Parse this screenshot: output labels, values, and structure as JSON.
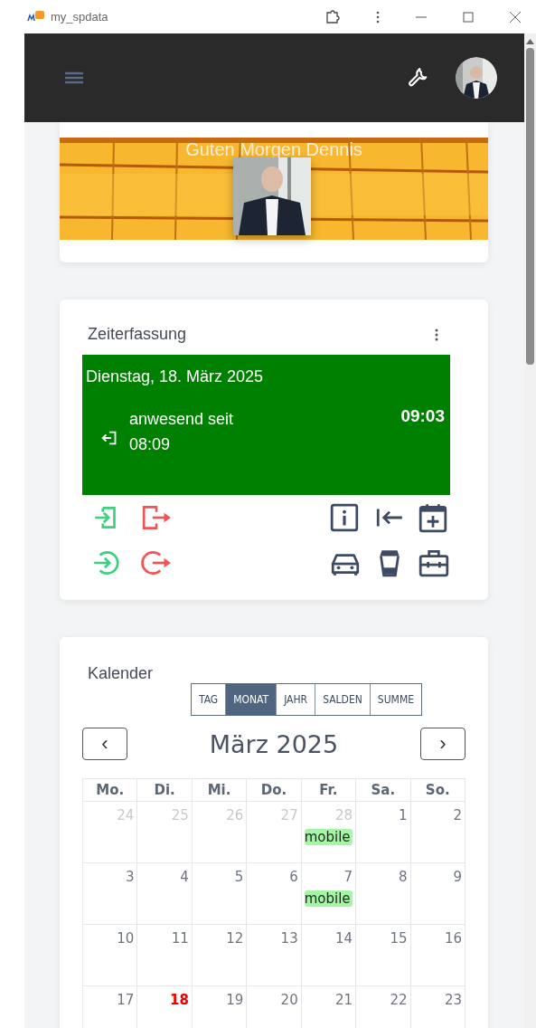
{
  "window": {
    "title": "my_spdata"
  },
  "greeting": {
    "text": "Guten Morgen Dennis"
  },
  "time_tracking": {
    "title": "Zeiterfassung",
    "date": "Dienstag, 18. März 2025",
    "status": "anwesend seit",
    "since": "08:09",
    "current_time": "09:03"
  },
  "calendar": {
    "title": "Kalender",
    "month": "März 2025",
    "prev": "‹",
    "next": "›",
    "views": [
      {
        "label": "TAG",
        "selected": false
      },
      {
        "label": "MONAT",
        "selected": true
      },
      {
        "label": "JAHR",
        "selected": false
      },
      {
        "label": "SALDEN",
        "selected": false
      },
      {
        "label": "SUMME",
        "selected": false
      }
    ],
    "weekdays": [
      "Mo.",
      "Di.",
      "Mi.",
      "Do.",
      "Fr.",
      "Sa.",
      "So."
    ],
    "weeks": [
      [
        {
          "day": "24",
          "outside": true,
          "today": false
        },
        {
          "day": "25",
          "outside": true,
          "today": false
        },
        {
          "day": "26",
          "outside": true,
          "today": false
        },
        {
          "day": "27",
          "outside": true,
          "today": false
        },
        {
          "day": "28",
          "outside": true,
          "today": false,
          "event": "mobile"
        },
        {
          "day": "1",
          "outside": false,
          "today": false
        },
        {
          "day": "2",
          "outside": false,
          "today": false
        }
      ],
      [
        {
          "day": "3",
          "outside": false,
          "today": false
        },
        {
          "day": "4",
          "outside": false,
          "today": false
        },
        {
          "day": "5",
          "outside": false,
          "today": false
        },
        {
          "day": "6",
          "outside": false,
          "today": false
        },
        {
          "day": "7",
          "outside": false,
          "today": false,
          "event": "mobile"
        },
        {
          "day": "8",
          "outside": false,
          "today": false
        },
        {
          "day": "9",
          "outside": false,
          "today": false
        }
      ],
      [
        {
          "day": "10",
          "outside": false,
          "today": false
        },
        {
          "day": "11",
          "outside": false,
          "today": false
        },
        {
          "day": "12",
          "outside": false,
          "today": false
        },
        {
          "day": "13",
          "outside": false,
          "today": false
        },
        {
          "day": "14",
          "outside": false,
          "today": false
        },
        {
          "day": "15",
          "outside": false,
          "today": false
        },
        {
          "day": "16",
          "outside": false,
          "today": false
        }
      ],
      [
        {
          "day": "17",
          "outside": false,
          "today": false
        },
        {
          "day": "18",
          "outside": false,
          "today": true
        },
        {
          "day": "19",
          "outside": false,
          "today": false
        },
        {
          "day": "20",
          "outside": false,
          "today": false
        },
        {
          "day": "21",
          "outside": false,
          "today": false
        },
        {
          "day": "22",
          "outside": false,
          "today": false
        },
        {
          "day": "23",
          "outside": false,
          "today": false
        }
      ]
    ]
  }
}
